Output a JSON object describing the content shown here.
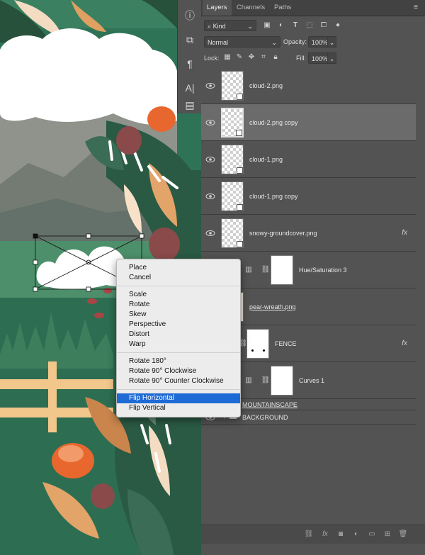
{
  "panel": {
    "tabs": [
      "Layers",
      "Channels",
      "Paths"
    ],
    "menu_icon": "hamburger-icon",
    "filter": {
      "kind_label": "Kind"
    },
    "blend_mode": "Normal",
    "opacity_label": "Opacity:",
    "opacity_value": "100%",
    "lock_label": "Lock:",
    "fill_label": "Fill:",
    "fill_value": "100%"
  },
  "layers": [
    {
      "name": "cloud-2.png"
    },
    {
      "name": "cloud-2.png copy"
    },
    {
      "name": "cloud-1.png"
    },
    {
      "name": "cloud-1.png copy"
    },
    {
      "name": "snowy-groundcover.png",
      "fx": "fx"
    },
    {
      "name": "Hue/Saturation 3"
    },
    {
      "name": "pear-wreath.png"
    },
    {
      "name": "FENCE",
      "fx": "fx"
    },
    {
      "name": "Curves 1"
    },
    {
      "name": "MOUNTAINSCAPE"
    },
    {
      "name": "BACKGROUND"
    }
  ],
  "context_menu": {
    "items": [
      "Place",
      "Cancel",
      "Scale",
      "Rotate",
      "Skew",
      "Perspective",
      "Distort",
      "Warp",
      "Rotate 180°",
      "Rotate 90° Clockwise",
      "Rotate 90° Counter Clockwise",
      "Flip Horizontal",
      "Flip Vertical"
    ],
    "highlighted": "Flip Horizontal"
  },
  "colors": {
    "canvas_green": "#2f7357",
    "panel_bg": "#535353",
    "selected_row": "#6b6b6b",
    "menu_highlight": "#1f6bd6"
  }
}
